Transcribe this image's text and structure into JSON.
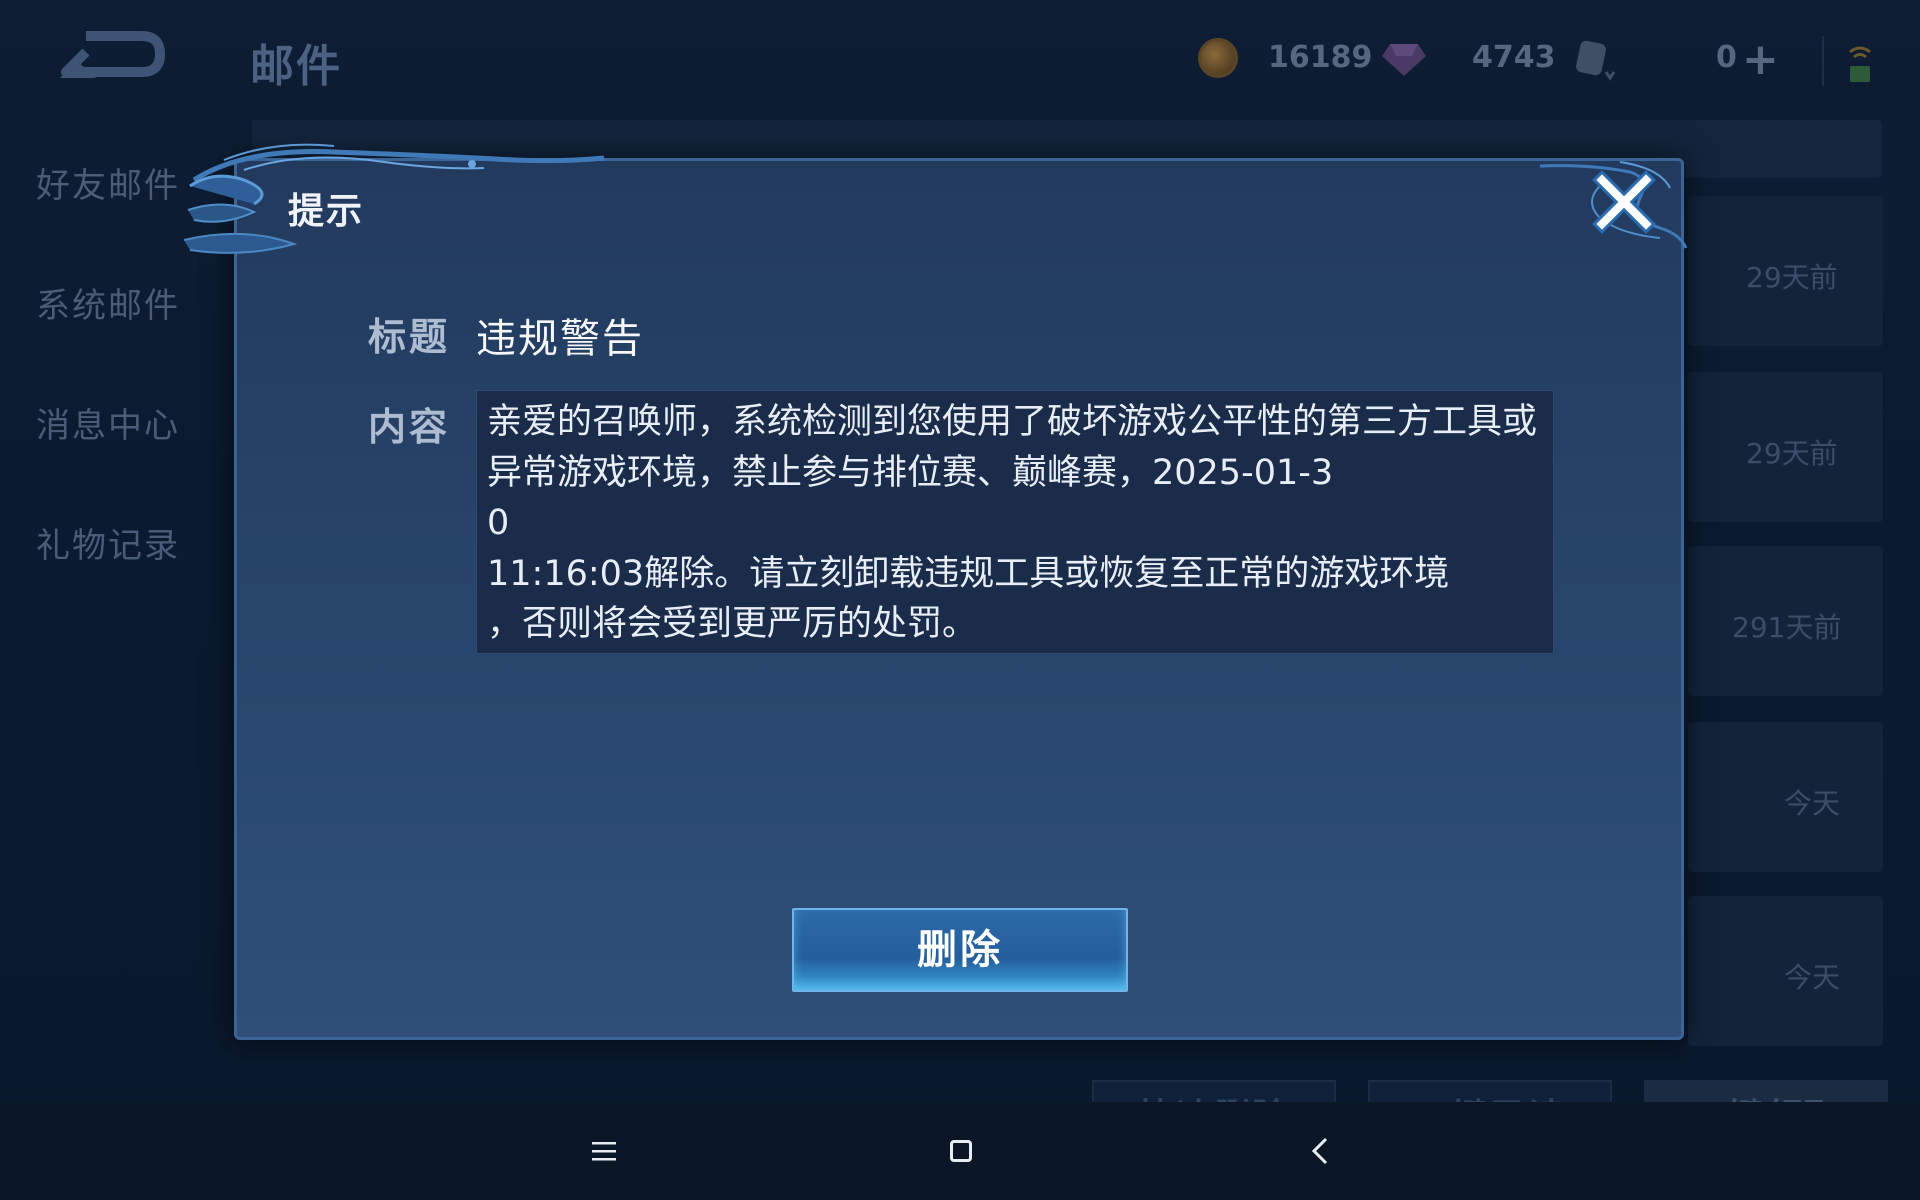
{
  "header": {
    "title": "邮件",
    "coins": "16189",
    "gems": "4743",
    "voucher": "0",
    "back_icon": "back-arrow-icon",
    "coin_icon": "gold-coin-icon",
    "gem_icon": "diamond-icon",
    "voucher_icon": "voucher-icon",
    "plus_icon": "plus-icon"
  },
  "sidebar": {
    "items": [
      {
        "label": "好友邮件"
      },
      {
        "label": "系统邮件"
      },
      {
        "label": "消息中心"
      },
      {
        "label": "礼物记录"
      }
    ]
  },
  "mail_list": {
    "times": [
      "29天前",
      "29天前",
      "291天前",
      "今天",
      "今天"
    ]
  },
  "bottom_actions": {
    "quick_delete": "快速删除",
    "mark_all_read": "一键已读",
    "claim_all": "一键领取"
  },
  "dialog": {
    "title": "提示",
    "subject_label": "标题",
    "subject_value": "违规警告",
    "content_label": "内容",
    "content_value": "亲爱的召唤师，系统检测到您使用了破坏游戏公平性的第三方工具或异常游戏环境，禁止参与排位赛、巅峰赛，2025-01-3\n0\n11:16:03解除。请立刻卸载违规工具或恢复至正常的游戏环境\n，否则将会受到更严厉的处罚。",
    "delete_label": "删除",
    "close_icon": "close-icon"
  },
  "colors": {
    "dialog_bg": "#29476e",
    "dialog_border": "#3c6597",
    "button_blue": "#2c6aa8"
  }
}
